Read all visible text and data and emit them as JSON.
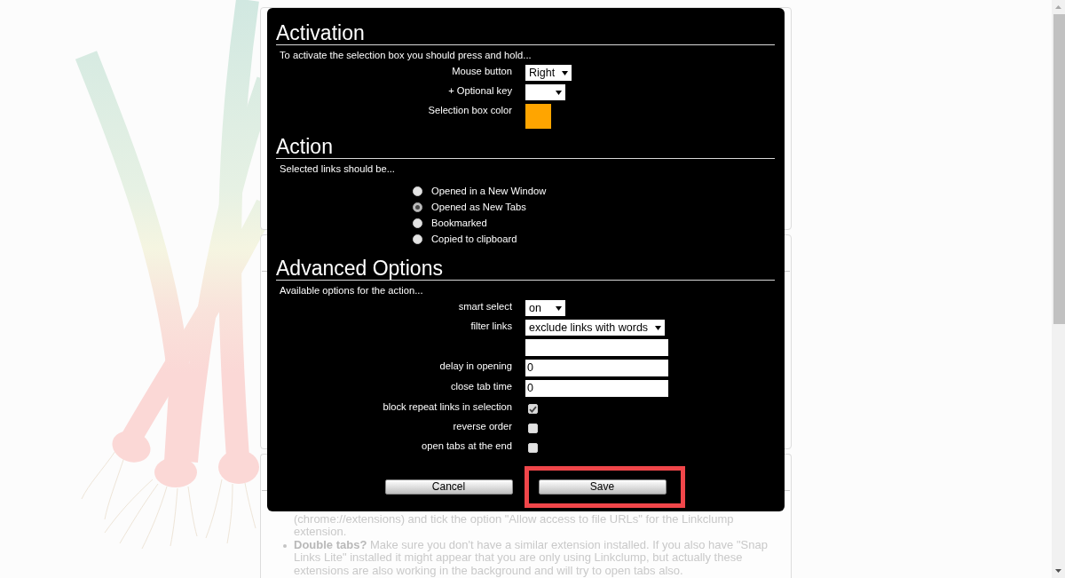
{
  "background_notes": [
    {
      "bullet": false,
      "text": "(chrome://extensions) and tick the option \"Allow access to file URLs\" for the Linkclump extension."
    },
    {
      "bullet": true,
      "text": "**Double tabs?** Make sure you don't have a similar extension installed. If you also have \"Snap Links Lite\" installed it might appear that you are only using Linkclump, but actually these extensions are also working in the background and will try to open tabs also."
    }
  ],
  "dialog": {
    "sections": [
      {
        "kind": "fields",
        "title": "Activation",
        "intro": "To activate the selection box you should press and hold...",
        "rows": [
          {
            "kind": "select",
            "label": "Mouse button",
            "value": "Right"
          },
          {
            "kind": "select",
            "label": "+ Optional key"
          },
          {
            "kind": "color",
            "label": "Selection box color",
            "color": "#ffa500"
          }
        ]
      },
      {
        "kind": "radios",
        "title": "Action",
        "intro": "Selected links should be...",
        "options": [
          {
            "label": "Opened in a New Window",
            "selected": false
          },
          {
            "label": "Opened as New Tabs",
            "selected": true
          },
          {
            "label": "Bookmarked",
            "selected": false
          },
          {
            "label": "Copied to clipboard",
            "selected": false
          }
        ]
      },
      {
        "kind": "fields",
        "title": "Advanced Options",
        "intro": "Available options for the action...",
        "rows": [
          {
            "kind": "select",
            "label": "smart select",
            "value": "on"
          },
          {
            "kind": "select",
            "label": "filter links",
            "value": "exclude links with words"
          },
          {
            "kind": "text"
          },
          {
            "kind": "text",
            "label": "delay in opening",
            "value": "0"
          },
          {
            "kind": "text",
            "label": "close tab time",
            "value": "0"
          },
          {
            "kind": "checkbox",
            "label": "block repeat links in selection",
            "checked": true
          },
          {
            "kind": "checkbox",
            "label": "reverse order",
            "checked": false
          },
          {
            "kind": "checkbox",
            "label": "open tabs at the end",
            "checked": false
          }
        ]
      }
    ],
    "buttons": [
      {
        "label": "Cancel",
        "highlighted": false
      },
      {
        "label": "Save",
        "highlighted": true
      }
    ]
  }
}
